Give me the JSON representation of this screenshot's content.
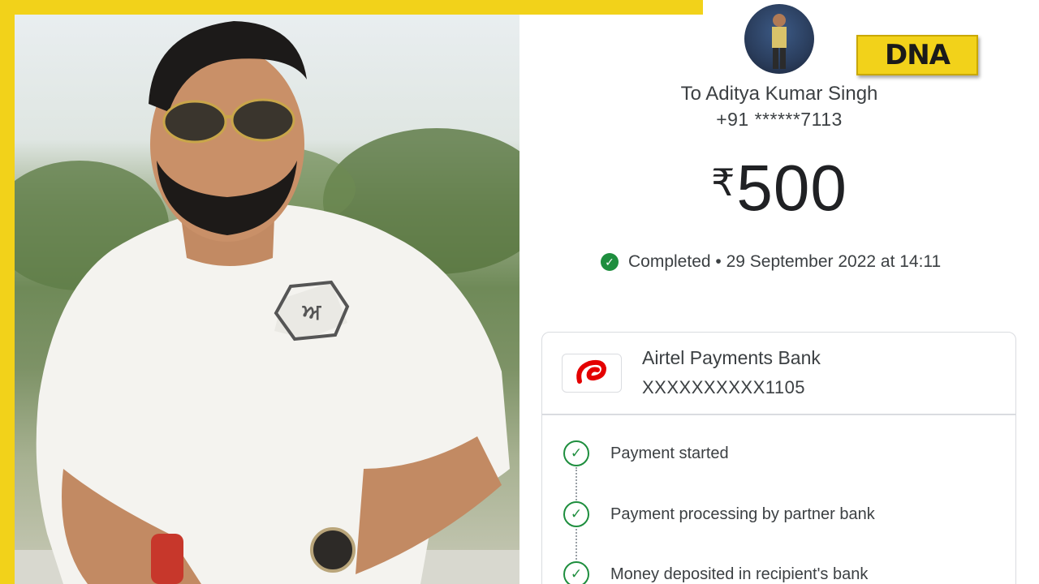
{
  "branding": {
    "logo_text": "DNA",
    "accent": "#f2d21a"
  },
  "transaction": {
    "recipient_name": "To Aditya Kumar Singh",
    "recipient_phone": "+91 ******7113",
    "currency_symbol": "₹",
    "amount": "500",
    "status": "Completed",
    "timestamp": "29 September 2022 at 14:11",
    "status_color": "#1e8e3e"
  },
  "bank": {
    "name": "Airtel Payments Bank",
    "account": "XXXXXXXXXX1105",
    "logo_icon": "airtel-logo-icon"
  },
  "steps": [
    {
      "label": "Payment started"
    },
    {
      "label": "Payment processing by partner bank"
    },
    {
      "label": "Money deposited in recipient's bank"
    }
  ]
}
